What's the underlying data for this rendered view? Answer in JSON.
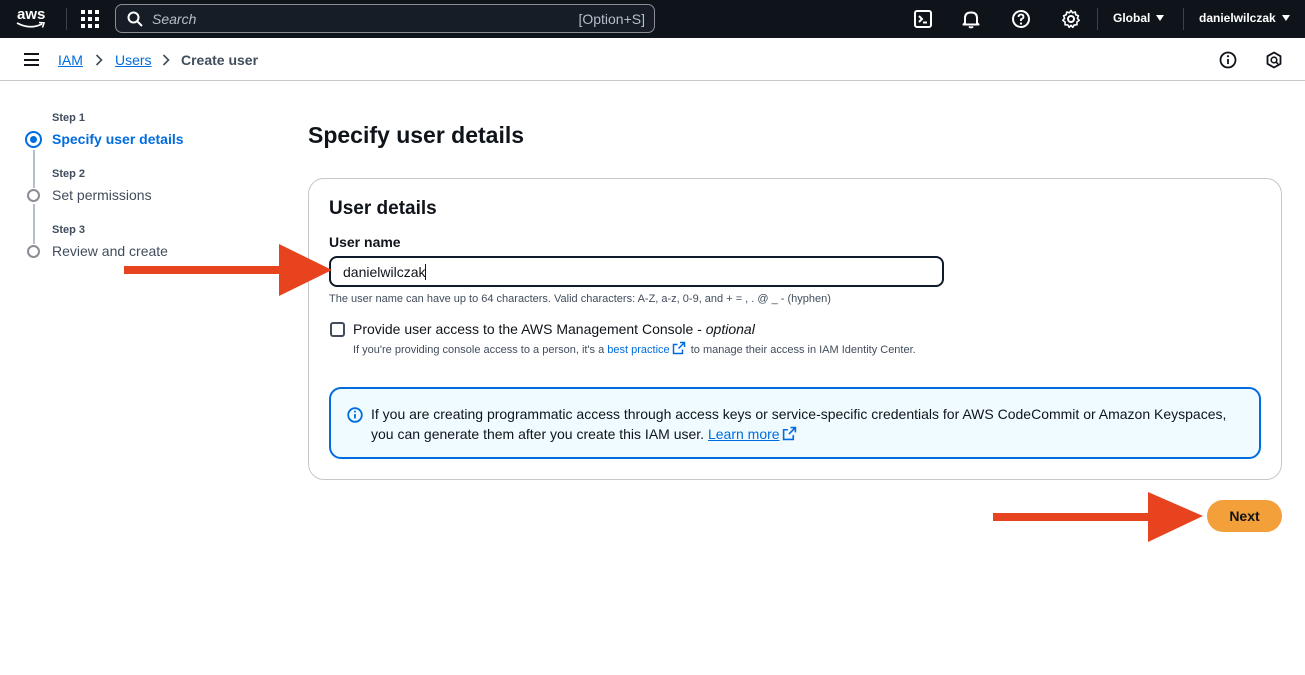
{
  "topnav": {
    "logo_text": "aws",
    "search_placeholder": "Search",
    "search_shortcut": "[Option+S]",
    "region": "Global",
    "account": "danielwilczak"
  },
  "breadcrumb": {
    "items": [
      "IAM",
      "Users"
    ],
    "current": "Create user"
  },
  "steps": [
    {
      "step": "Step 1",
      "label": "Specify user details"
    },
    {
      "step": "Step 2",
      "label": "Set permissions"
    },
    {
      "step": "Step 3",
      "label": "Review and create"
    }
  ],
  "page": {
    "title": "Specify user details"
  },
  "user_details": {
    "title": "User details",
    "field_label": "User name",
    "field_value": "danielwilczak",
    "hint": "The user name can have up to 64 characters. Valid characters: A-Z, a-z, 0-9, and + = , . @ _ - (hyphen)",
    "console_checkbox_label": "Provide user access to the AWS Management Console - ",
    "console_checkbox_optional": "optional",
    "console_desc_before": "If you're providing console access to a person, it's a ",
    "console_desc_link": "best practice",
    "console_desc_after": " to manage their access in IAM Identity Center."
  },
  "alert": {
    "text": "If you are creating programmatic access through access keys or service-specific credentials for AWS CodeCommit or Amazon Keyspaces, you can generate them after you create this IAM user. ",
    "link": "Learn more"
  },
  "actions": {
    "next_label": "Next"
  },
  "colors": {
    "accent": "#006ce0",
    "primary_button": "#f3a03a",
    "annotation_arrow": "#e8431f",
    "nav_bg": "#0f141a"
  }
}
